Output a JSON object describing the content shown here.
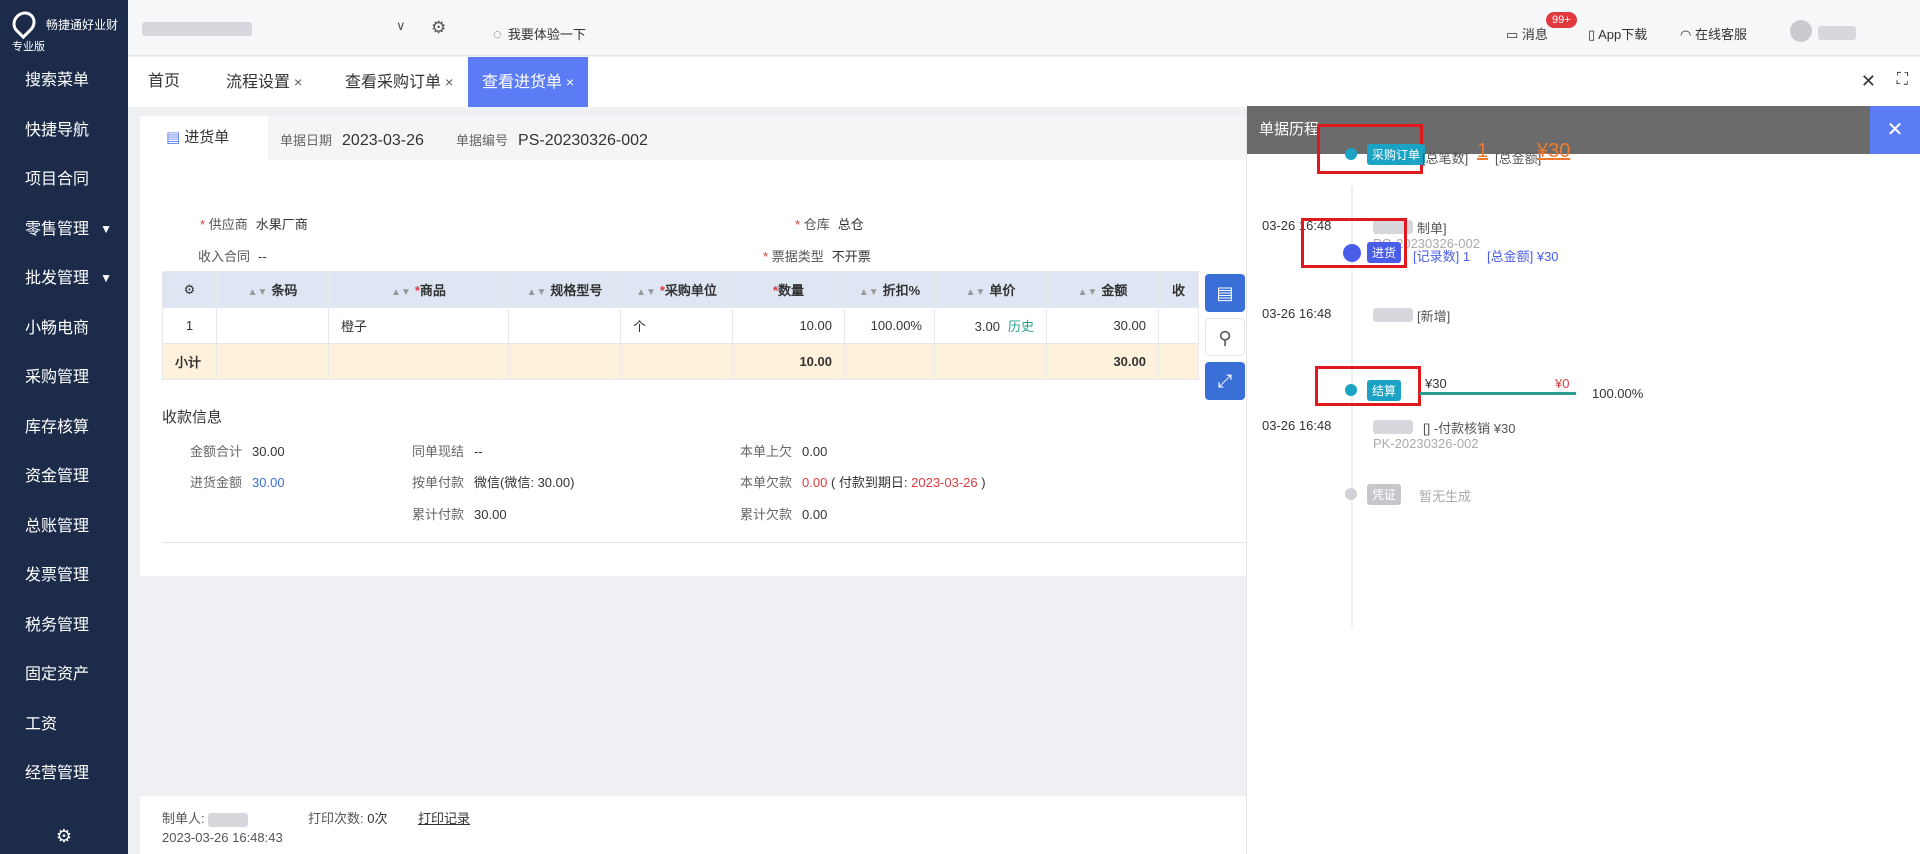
{
  "app": {
    "brand": "畅捷通好业财",
    "edition": "专业版"
  },
  "sidebar": {
    "items": [
      {
        "label": "搜索菜单",
        "caret": false
      },
      {
        "label": "快捷导航",
        "caret": false
      },
      {
        "label": "项目合同",
        "caret": false
      },
      {
        "label": "零售管理",
        "caret": true
      },
      {
        "label": "批发管理",
        "caret": true
      },
      {
        "label": "小畅电商",
        "caret": false
      },
      {
        "label": "采购管理",
        "caret": false
      },
      {
        "label": "库存核算",
        "caret": false
      },
      {
        "label": "资金管理",
        "caret": false
      },
      {
        "label": "总账管理",
        "caret": false
      },
      {
        "label": "发票管理",
        "caret": false
      },
      {
        "label": "税务管理",
        "caret": false
      },
      {
        "label": "固定资产",
        "caret": false
      },
      {
        "label": "工资",
        "caret": false
      },
      {
        "label": "经营管理",
        "caret": false
      }
    ]
  },
  "topbar": {
    "experience": "我要体验一下",
    "messages": "消息",
    "messages_badge": "99+",
    "app_download": "App下载",
    "support": "在线客服"
  },
  "tabs": [
    {
      "label": "首页",
      "closable": false,
      "active": false
    },
    {
      "label": "流程设置",
      "closable": true,
      "active": false
    },
    {
      "label": "查看采购订单",
      "closable": true,
      "active": false
    },
    {
      "label": "查看进货单",
      "closable": true,
      "active": true
    }
  ],
  "doc": {
    "tab_label": "进货单",
    "date_label": "单据日期",
    "date": "2023-03-26",
    "number_label": "单据编号",
    "number": "PS-20230326-002",
    "supplier_label": "供应商",
    "supplier": "水果厂商",
    "warehouse_label": "仓库",
    "warehouse": "总仓",
    "contract_label": "收入合同",
    "contract": "--",
    "invoice_type_label": "票据类型",
    "invoice_type": "不开票"
  },
  "table": {
    "headers": [
      "条码",
      "商品",
      "规格型号",
      "采购单位",
      "数量",
      "折扣%",
      "单价",
      "金额",
      "收"
    ],
    "rows": [
      {
        "idx": "1",
        "barcode": "",
        "product": "橙子",
        "spec": "",
        "unit": "个",
        "qty": "10.00",
        "discount": "100.00%",
        "price": "3.00",
        "history": "历史",
        "amount": "30.00"
      }
    ],
    "subtotal": {
      "label": "小计",
      "qty": "10.00",
      "amount": "30.00"
    }
  },
  "payment": {
    "title": "收款信息",
    "total_label": "金额合计",
    "total": "30.00",
    "purchase_amount_label": "进货金额",
    "purchase_amount": "30.00",
    "same_settle_label": "同单现结",
    "same_settle": "--",
    "by_order_label": "按单付款",
    "by_order": "微信(微信: 30.00)",
    "cumulative_paid_label": "累计付款",
    "cumulative_paid": "30.00",
    "prev_owed_label": "本单上欠",
    "prev_owed": "0.00",
    "owed_label": "本单欠款",
    "owed": "0.00",
    "due_prefix": "( 付款到期日:",
    "due_date": "2023-03-26",
    "due_suffix": ")",
    "cumulative_owed_label": "累计欠款",
    "cumulative_owed": "0.00"
  },
  "footer": {
    "creator_label": "制单人:",
    "created_at": "2023-03-26 16:48:43",
    "print_count_label": "打印次数:",
    "print_count": "0次",
    "print_log": "打印记录"
  },
  "history": {
    "title": "单据历程",
    "po": {
      "tag": "采购订单",
      "count_label": "[总笔数]",
      "count": "1",
      "amount_label": "[总金额]",
      "amount": "¥30"
    },
    "po_log": {
      "time": "03-26 16:48",
      "action": "制单]",
      "doc": "PO-20230326-002"
    },
    "receipt": {
      "tag": "进货",
      "count_label": "[记录数] 1",
      "amount_label": "[总金额] ¥30"
    },
    "receipt_log": {
      "time": "03-26 16:48",
      "action": "[新增]"
    },
    "settle": {
      "tag": "结算",
      "paid": "¥30",
      "remain": "¥0",
      "percent": "100.00%"
    },
    "settle_log": {
      "time": "03-26 16:48",
      "action": "[] -付款核销  ¥30",
      "doc": "PK-20230326-002"
    },
    "voucher": {
      "tag": "凭证",
      "status": "暂无生成"
    }
  }
}
